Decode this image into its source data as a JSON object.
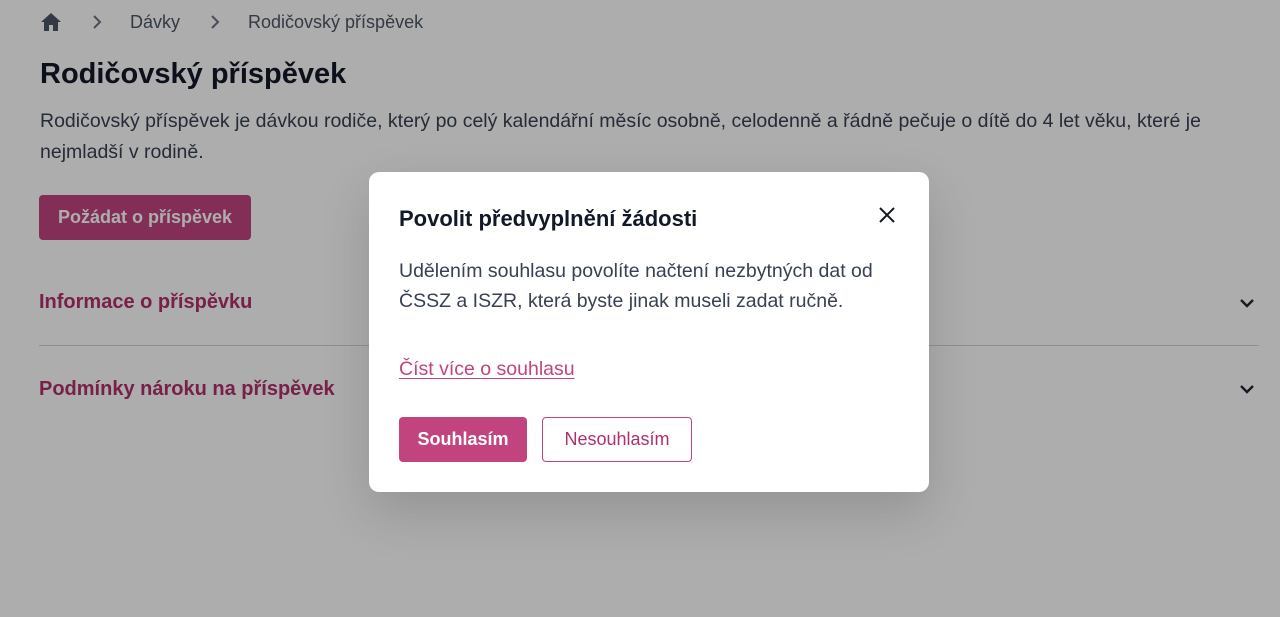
{
  "breadcrumb": {
    "home_icon": "home-icon",
    "items": [
      "Dávky",
      "Rodičovský příspěvek"
    ]
  },
  "page": {
    "title": "Rodičovský příspěvek",
    "description": "Rodičovský příspěvek je dávkou rodiče, který po celý kalendářní měsíc osobně, celodenně a řádně pečuje o dítě do 4 let věku, které je nejmladší v rodině.",
    "apply_button": "Požádat o příspěvek"
  },
  "accordions": [
    {
      "label": "Informace o příspěvku",
      "icon": "chevron-down-icon"
    },
    {
      "label": "Podmínky nároku na příspěvek",
      "icon": "chevron-down-icon"
    }
  ],
  "modal": {
    "title": "Povolit předvyplnění žádosti",
    "body": "Udělením souhlasu povolíte načtení nezbytných dat od ČSSZ a ISZR, která byste jinak museli zadat ručně.",
    "link": "Číst více o souhlasu",
    "agree_button": "Souhlasím",
    "disagree_button": "Nesouhlasím",
    "close_icon": "close-icon"
  },
  "colors": {
    "accent": "#c2447f",
    "accent_text": "#b0306c",
    "overlay": "rgba(0,0,0,0.32)"
  }
}
